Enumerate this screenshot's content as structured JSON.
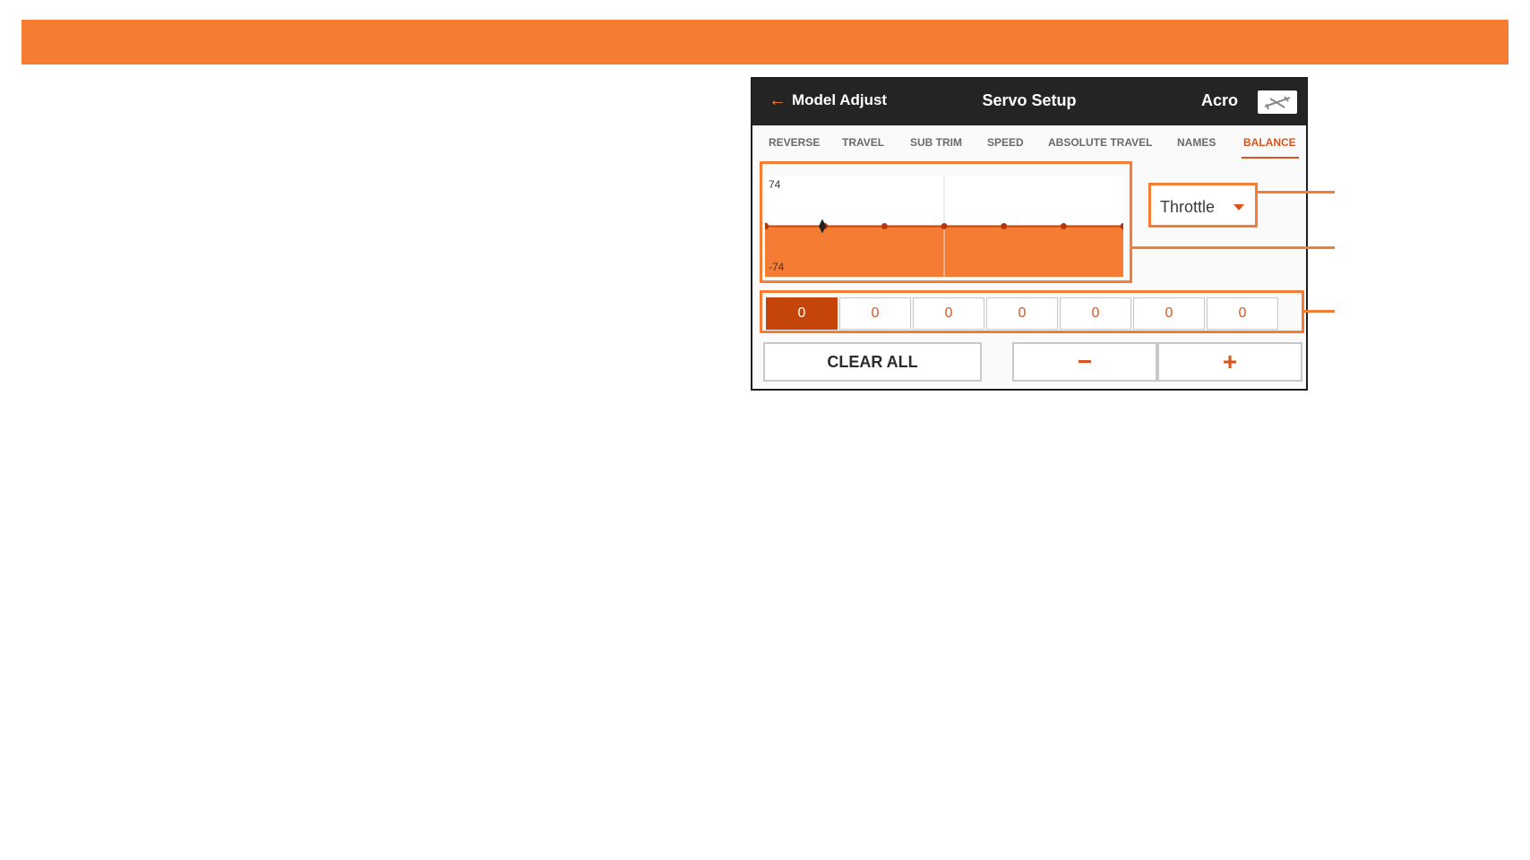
{
  "colors": {
    "accent": "#f47c33",
    "accent_dark": "#c4440a",
    "header_bg": "#242424"
  },
  "header": {
    "back_label": "Model Adjust",
    "title": "Servo Setup",
    "model_type": "Acro",
    "model_icon": "airplane-icon"
  },
  "tabs": [
    {
      "label": "REVERSE",
      "active": false
    },
    {
      "label": "TRAVEL",
      "active": false
    },
    {
      "label": "SUB TRIM",
      "active": false
    },
    {
      "label": "SPEED",
      "active": false
    },
    {
      "label": "ABSOLUTE TRAVEL",
      "active": false
    },
    {
      "label": "NAMES",
      "active": false
    },
    {
      "label": "BALANCE",
      "active": true
    }
  ],
  "graph": {
    "max_label": "74",
    "min_label": "-74",
    "points": [
      0,
      0,
      0,
      0,
      0,
      0,
      0
    ]
  },
  "channel_select": {
    "value": "Throttle"
  },
  "balance_values": [
    {
      "value": "0",
      "selected": true
    },
    {
      "value": "0",
      "selected": false
    },
    {
      "value": "0",
      "selected": false
    },
    {
      "value": "0",
      "selected": false
    },
    {
      "value": "0",
      "selected": false
    },
    {
      "value": "0",
      "selected": false
    },
    {
      "value": "0",
      "selected": false
    }
  ],
  "buttons": {
    "clear_all": "CLEAR ALL",
    "minus": "−",
    "plus": "+"
  }
}
